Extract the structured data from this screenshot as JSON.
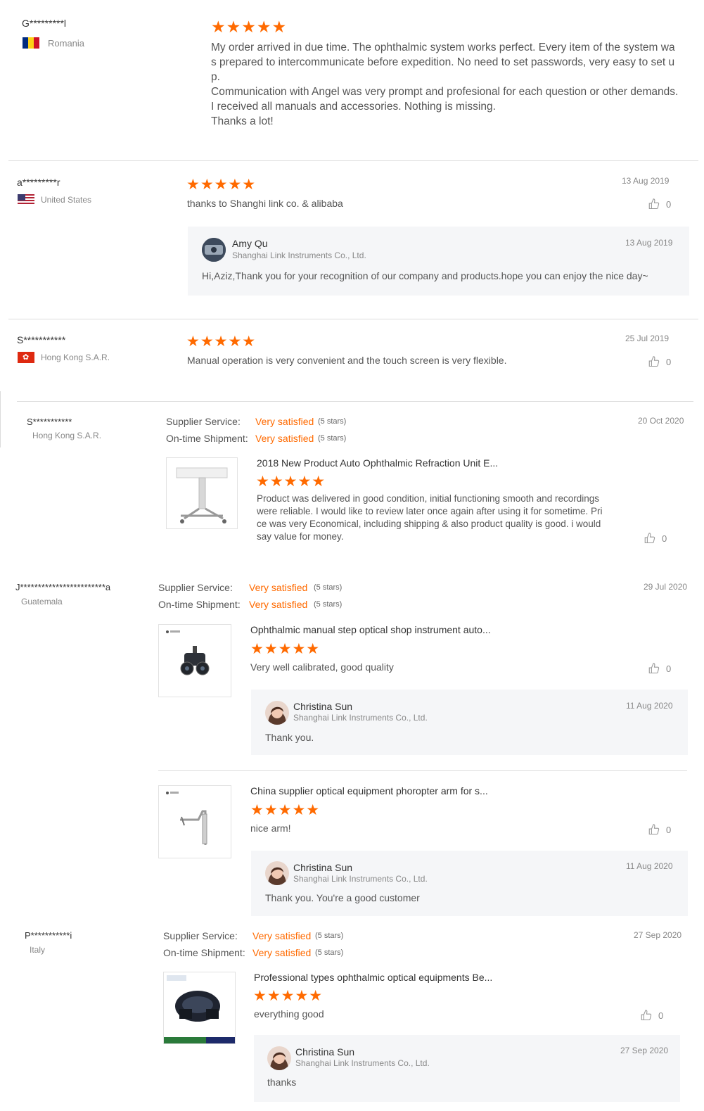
{
  "reviews": [
    {
      "user": "G*********l",
      "country": "Romania",
      "stars": "★★★★★",
      "text": "My order arrived in due time. The ophthalmic system works perfect. Every item of the system was prepared to intercommunicate before expedition. No need to set passwords, very easy to set up.\nCommunication with Angel was very prompt and profesional for each question or other demands. I received all manuals and accessories. Nothing is missing.\nThanks a lot!"
    },
    {
      "user": "a*********r",
      "country": "United States",
      "stars": "★★★★★",
      "text": "thanks to Shanghi link co.  &  alibaba",
      "date": "13 Aug 2019",
      "likes": "0",
      "reply": {
        "name": "Amy Qu",
        "company": "Shanghai Link Instruments Co., Ltd.",
        "date": "13 Aug 2019",
        "text": "Hi,Aziz,Thank you for your recognition of our company and products.hope you can enjoy the nice day~"
      }
    },
    {
      "user": "S***********",
      "country": "Hong Kong S.A.R.",
      "stars": "★★★★★",
      "text": "Manual operation is very convenient and the touch screen is very flexible.",
      "date": "25 Jul 2019",
      "likes": "0"
    },
    {
      "user": "S***********",
      "country": "Hong Kong S.A.R.",
      "supplier_label": "Supplier Service:",
      "supplier_value": "Very satisfied",
      "supplier_note": "(5 stars)",
      "shipment_label": "On-time Shipment:",
      "shipment_value": "Very satisfied",
      "shipment_note": "(5 stars)",
      "date": "20 Oct 2020",
      "product": "2018 New Product Auto Ophthalmic Refraction Unit E...",
      "stars": "★★★★★",
      "text": "Product was delivered in good condition, initial functioning smooth and recordings were reliable. I would like to review later once again after using it for sometime. Price was very Economical, including shipping & also product quality is good. i would say value for money.",
      "likes": "0"
    },
    {
      "user": "J************************a",
      "country": "Guatemala",
      "supplier_label": "Supplier Service:",
      "supplier_value": "Very satisfied",
      "supplier_note": "(5 stars)",
      "shipment_label": "On-time Shipment:",
      "shipment_value": "Very satisfied",
      "shipment_note": "(5 stars)",
      "date": "29 Jul 2020",
      "items": [
        {
          "product": "Ophthalmic manual step optical shop instrument auto...",
          "stars": "★★★★★",
          "text": "Very well calibrated, good quality",
          "likes": "0",
          "reply": {
            "name": "Christina Sun",
            "company": "Shanghai Link Instruments Co., Ltd.",
            "date": "11 Aug 2020",
            "text": "Thank you."
          }
        },
        {
          "product": "China supplier optical equipment phoropter arm for s...",
          "stars": "★★★★★",
          "text": "nice arm!",
          "likes": "0",
          "reply": {
            "name": "Christina Sun",
            "company": "Shanghai Link Instruments Co., Ltd.",
            "date": "11 Aug 2020",
            "text": "Thank you. You're a good customer"
          }
        }
      ]
    },
    {
      "user": "P***********i",
      "country": "Italy",
      "supplier_label": "Supplier Service:",
      "supplier_value": "Very satisfied",
      "supplier_note": "(5 stars)",
      "shipment_label": "On-time Shipment:",
      "shipment_value": "Very satisfied",
      "shipment_note": "(5 stars)",
      "date": "27 Sep 2020",
      "product": "Professional types ophthalmic optical equipments Be...",
      "stars": "★★★★★",
      "text": "everything good",
      "likes": "0",
      "reply": {
        "name": "Christina Sun",
        "company": "Shanghai Link Instruments Co., Ltd.",
        "date": "27 Sep 2020",
        "text": "thanks"
      }
    }
  ],
  "icons": {
    "like": "thumbs-up-icon",
    "star": "star-icon"
  },
  "colors": {
    "accent": "#ff6a00",
    "reply_bg": "#f5f6f8"
  }
}
